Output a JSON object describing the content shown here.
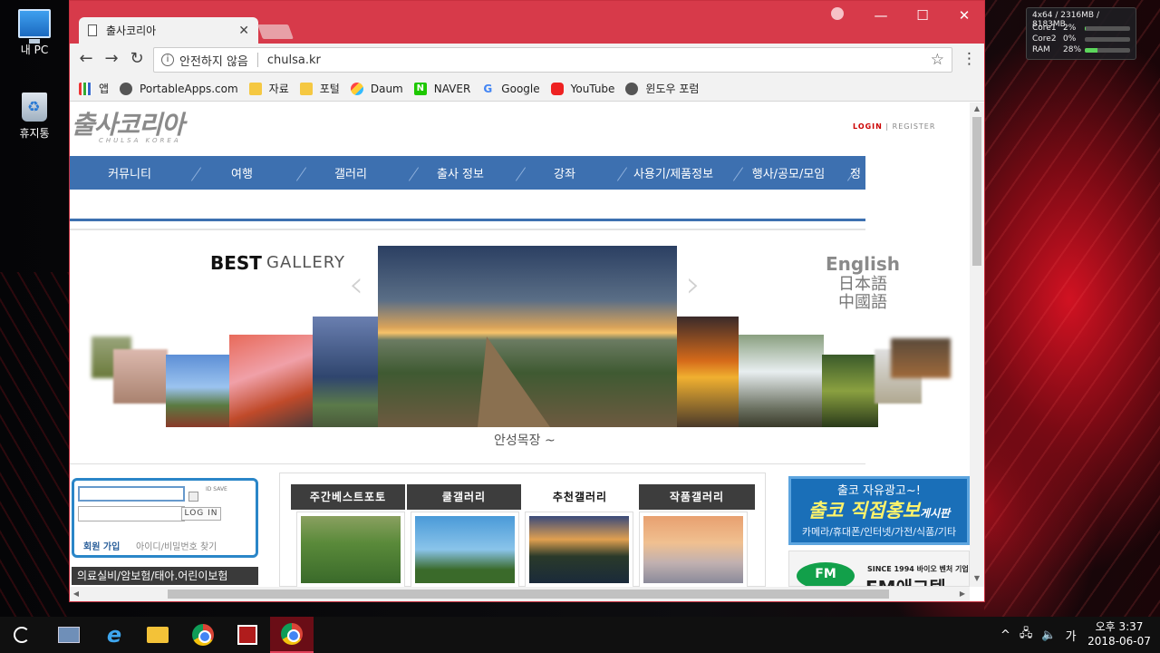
{
  "desktop": {
    "icons": [
      {
        "label": "내 PC"
      },
      {
        "label": "휴지통"
      }
    ]
  },
  "browser": {
    "tab_title": "출사코리아",
    "address": {
      "security_text": "안전하지 않음",
      "url": "chulsa.kr"
    },
    "bookmarks": [
      {
        "label": "앱",
        "icon": "apps-icon"
      },
      {
        "label": "PortableApps.com",
        "icon": "portableapps-icon"
      },
      {
        "label": "자료",
        "icon": "folder-icon"
      },
      {
        "label": "포털",
        "icon": "folder-icon"
      },
      {
        "label": "Daum",
        "icon": "daum-icon"
      },
      {
        "label": "NAVER",
        "icon": "naver-icon"
      },
      {
        "label": "Google",
        "icon": "google-icon"
      },
      {
        "label": "YouTube",
        "icon": "youtube-icon"
      },
      {
        "label": "윈도우 포럼",
        "icon": "windows-forum-icon"
      }
    ]
  },
  "page": {
    "logo_main": "출사코리아",
    "logo_sub": "CHULSA KOREA",
    "auth": {
      "login": "LOGIN",
      "separator": "|",
      "register": "REGISTER"
    },
    "nav": [
      "커뮤니티",
      "여행",
      "갤러리",
      "출사 정보",
      "강좌",
      "사용기/제품정보",
      "행사/공모/모임",
      "정"
    ],
    "best": {
      "best_word": "BEST",
      "gallery_word": "GALLERY",
      "caption": "안성목장 ~"
    },
    "languages": [
      "English",
      "日本語",
      "中國語"
    ],
    "login_box": {
      "id_save": "ID SAVE",
      "login_button": "LOG IN",
      "join": "회원 가입",
      "find": "아이디/비밀번호 찾기"
    },
    "insurance_ad": "의료실비/암보험/태아.어린이보험",
    "gallery_tabs": [
      {
        "label": "주간베스트포토",
        "active": false
      },
      {
        "label": "쿨갤러리",
        "active": false
      },
      {
        "label": "추천갤러리",
        "active": true
      },
      {
        "label": "작품갤러리",
        "active": false
      }
    ],
    "ad_blue": {
      "line1": "출코 자유광고~!",
      "line2": "출코 직접홍보",
      "line2_small": "게시판",
      "line3": "카메라/휴대폰/인터넷/가전/식품/기타"
    },
    "ad_fm": {
      "logo": "FM",
      "since": "SINCE 1994  바이오 벤처 기업",
      "name": "FM애그텍"
    }
  },
  "sysmon": {
    "header": "4x64 / 2316MB / 8183MB",
    "rows": [
      {
        "label": "Core1",
        "value": "2%",
        "fill": 0.02
      },
      {
        "label": "Core2",
        "value": "0%",
        "fill": 0.0
      },
      {
        "label": "RAM",
        "value": "28%",
        "fill": 0.28
      }
    ]
  },
  "taskbar": {
    "ime": "가",
    "time": "오후 3:37",
    "date": "2018-06-07"
  }
}
